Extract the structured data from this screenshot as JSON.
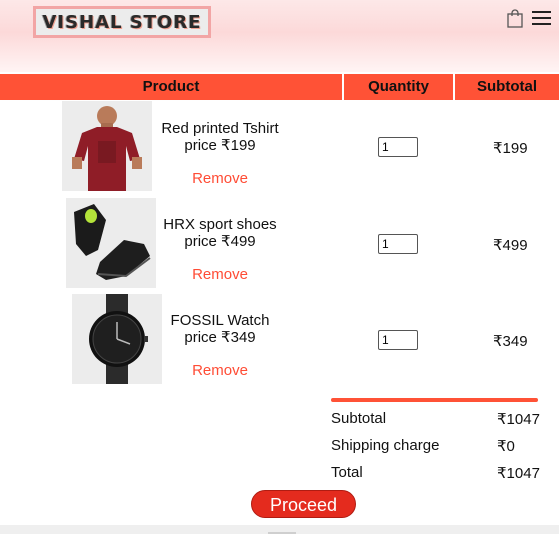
{
  "header": {
    "logo_text": "VISHAL STORE",
    "icons": [
      "shopping-bag-icon",
      "hamburger-menu-icon"
    ]
  },
  "table": {
    "headers": {
      "product": "Product",
      "quantity": "Quantity",
      "subtotal": "Subtotal"
    },
    "rows": [
      {
        "name": "Red printed Tshirt",
        "price": "price ₹199",
        "remove": "Remove",
        "quantity": "1",
        "subtotal": "₹199",
        "image": "red-tshirt-image"
      },
      {
        "name": "HRX sport shoes",
        "price": "price ₹499",
        "remove": "Remove",
        "quantity": "1",
        "subtotal": "₹499",
        "image": "black-sport-shoes-image"
      },
      {
        "name": "FOSSIL Watch",
        "price": "price ₹349",
        "remove": "Remove",
        "quantity": "1",
        "subtotal": "₹349",
        "image": "black-watch-image"
      }
    ]
  },
  "totals": {
    "subtotal_label": "Subtotal",
    "subtotal_value": "₹1047",
    "shipping_label": "Shipping charge",
    "shipping_value": "₹0",
    "total_label": "Total",
    "total_value": "₹1047"
  },
  "actions": {
    "proceed_label": "Proceed"
  },
  "colors": {
    "accent": "#ff5236",
    "button": "#e42b1e",
    "link": "#ff4c35"
  }
}
